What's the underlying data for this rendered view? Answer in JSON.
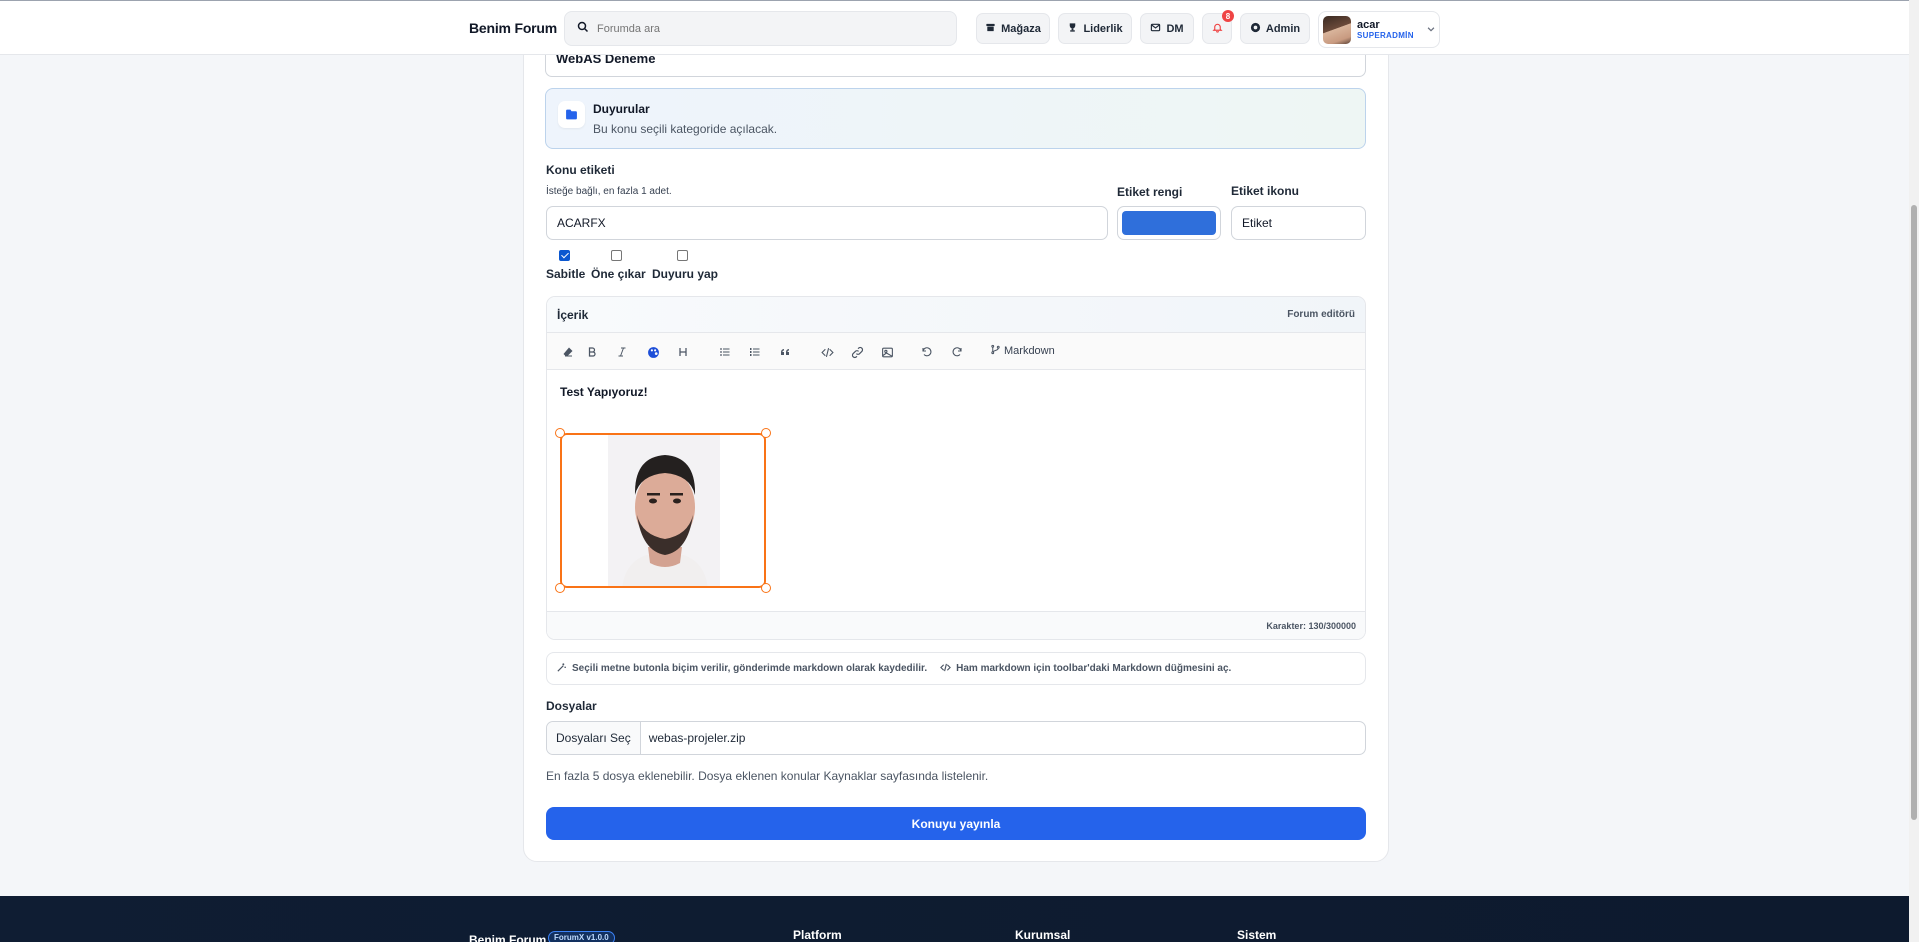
{
  "header": {
    "brand": "Benim Forum",
    "search_placeholder": "Forumda ara",
    "nav": {
      "store": "Mağaza",
      "leaderboard": "Liderlik",
      "dm": "DM",
      "notifications_count": "8",
      "admin": "Admin"
    },
    "user": {
      "name": "acar",
      "role": "SUPERADMİN"
    }
  },
  "form": {
    "title_value": "WebAS Deneme",
    "category": {
      "title": "Duyurular",
      "subtitle": "Bu konu seçili kategoride açılacak."
    },
    "tag": {
      "label": "Konu etiketi",
      "hint": "İsteğe bağlı, en fazla 1 adet.",
      "value": "ACARFX",
      "color_label": "Etiket rengi",
      "color_value": "#2f6fdb",
      "icon_label": "Etiket ikonu",
      "icon_value": "Etiket"
    },
    "options": [
      {
        "label": "Sabitle",
        "checked": true
      },
      {
        "label": "Öne çıkar",
        "checked": false
      },
      {
        "label": "Duyuru yap",
        "checked": false
      }
    ],
    "editor": {
      "title": "İçerik",
      "mode": "Forum editörü",
      "markdown_label": "Markdown",
      "toolbar_icons": [
        "eraser-icon",
        "bold-icon",
        "italic-icon",
        "palette-icon",
        "heading-icon",
        "bullet-list-icon",
        "numbered-list-icon",
        "quote-icon",
        "code-icon",
        "link-icon",
        "image-icon",
        "undo-icon",
        "redo-icon",
        "git-branch-icon"
      ],
      "content_heading": "Test Yapıyoruz!",
      "char_count": "Karakter: 130/300000"
    },
    "hint_bar": {
      "text1": "Seçili metne butonla biçim verilir, gönderimde markdown olarak kaydedilir.",
      "text2": "Ham markdown için toolbar'daki Markdown düğmesini aç."
    },
    "files": {
      "label": "Dosyalar",
      "button": "Dosyaları Seç",
      "selected": "webas-projeler.zip",
      "note": "En fazla 5 dosya eklenebilir. Dosya eklenen konular Kaynaklar sayfasında listelenir."
    },
    "submit": "Konuyu yayınla"
  },
  "footer": {
    "brand": "Benim Forum",
    "version": "ForumX v1.0.0",
    "columns": [
      "Platform",
      "Kurumsal",
      "Sistem"
    ]
  }
}
